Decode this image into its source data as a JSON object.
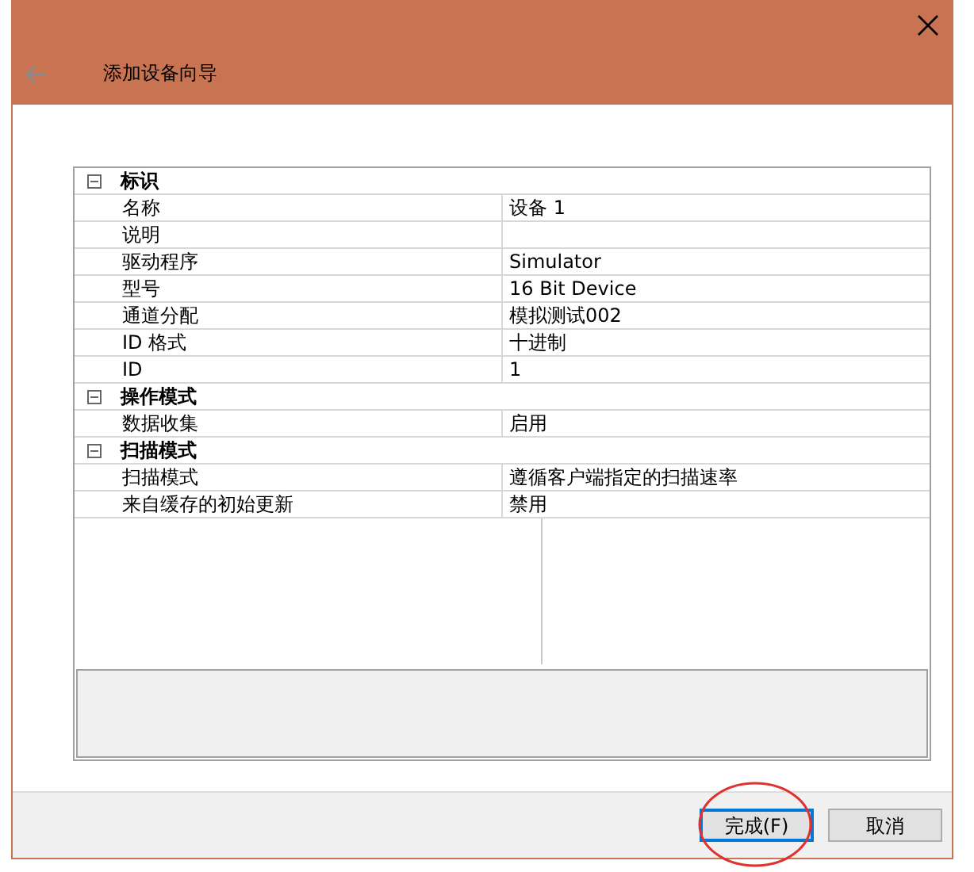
{
  "window": {
    "title": "添加设备向导",
    "back_disabled": true
  },
  "property_grid": {
    "groups": [
      {
        "title": "标识",
        "expanded": true,
        "rows": [
          {
            "name": "名称",
            "value": "设备 1"
          },
          {
            "name": "说明"
          },
          {
            "name": "驱动程序",
            "value": "Simulator"
          },
          {
            "name": "型号",
            "value": "16 Bit Device"
          },
          {
            "name": "通道分配",
            "value": "模拟测试002"
          },
          {
            "name": "ID 格式",
            "value": "十进制"
          },
          {
            "name": "ID",
            "value": "1"
          }
        ]
      },
      {
        "title": "操作模式",
        "expanded": true,
        "rows": [
          {
            "name": "数据收集",
            "value": "启用"
          }
        ]
      },
      {
        "title": "扫描模式",
        "expanded": true,
        "rows": [
          {
            "name": "扫描模式",
            "value": "遵循客户端指定的扫描速率"
          },
          {
            "name": "来自缓存的初始更新",
            "value": "禁用"
          }
        ]
      }
    ]
  },
  "buttons": [
    {
      "label": "完成(F)",
      "default": true,
      "circled": true
    },
    {
      "label": "取消",
      "default": false,
      "circled": false
    }
  ]
}
